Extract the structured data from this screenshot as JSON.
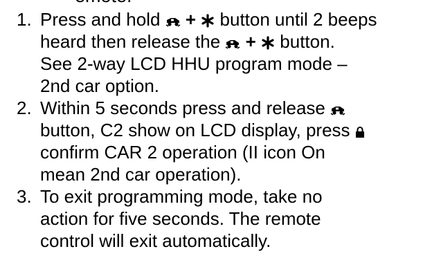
{
  "top_fragment": "emote:",
  "steps": [
    {
      "number": "1.",
      "l1a": "Press and hold ",
      "l1plus": " + ",
      "l1b": " button until 2 beeps",
      "l2a": "heard then release the ",
      "l2plus": " + ",
      "l2b": " button.",
      "l3": "See 2-way LCD HHU program mode –",
      "l4": "2nd car option."
    },
    {
      "number": "2.",
      "l1": "Within 5 seconds press and release ",
      "l2": "button, C2 show on LCD display, press ",
      "l3": "confirm CAR 2 operation (II icon On",
      "l4": "mean 2nd car operation)."
    },
    {
      "number": "3.",
      "l1": "To exit programming mode, take no",
      "l2": "action for five seconds. The remote",
      "l3": "control will exit automatically."
    }
  ],
  "icons": {
    "car": "car-icon",
    "star": "asterisk-icon",
    "lock": "lock-icon"
  }
}
